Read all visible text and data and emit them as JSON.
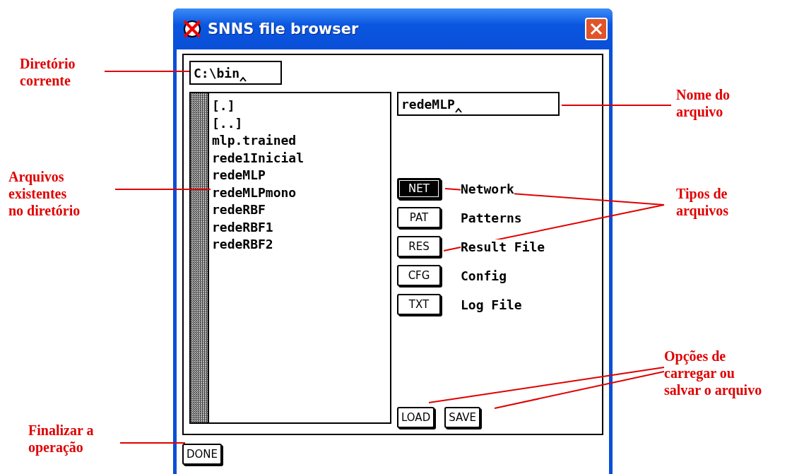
{
  "window": {
    "title": "SNNS file browser"
  },
  "directory": {
    "value": "C:\\bin"
  },
  "files": [
    "[.]",
    "[..]",
    "mlp.trained",
    "rede1Inicial",
    "redeMLP",
    "redeMLPmono",
    "redeRBF",
    "redeRBF1",
    "redeRBF2"
  ],
  "filename": {
    "value": "redeMLP"
  },
  "file_types": [
    {
      "button": "NET",
      "label": "Network",
      "selected": true
    },
    {
      "button": "PAT",
      "label": "Patterns",
      "selected": false
    },
    {
      "button": "RES",
      "label": "Result File",
      "selected": false
    },
    {
      "button": "CFG",
      "label": "Config",
      "selected": false
    },
    {
      "button": "TXT",
      "label": "Log File",
      "selected": false
    }
  ],
  "actions": [
    "LOAD",
    "SAVE"
  ],
  "done": "DONE",
  "annotations": [
    {
      "text": "Diretório\ncorrente"
    },
    {
      "text": "Nome do\narquivo"
    },
    {
      "text": "Arquivos\nexistentes\nno diretório"
    },
    {
      "text": "Tipos de\narquivos"
    },
    {
      "text": "Opções de\ncarregar ou\nsalvar o arquivo"
    },
    {
      "text": "Finalizar a\noperação"
    }
  ]
}
